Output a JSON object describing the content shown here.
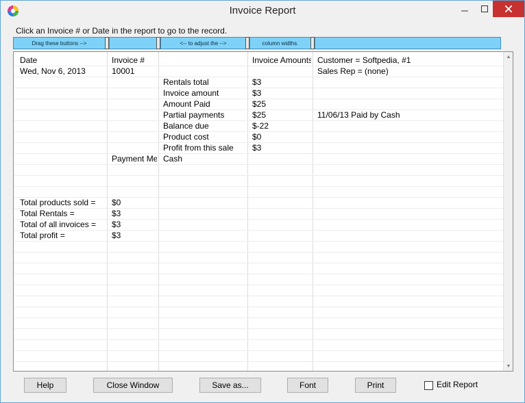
{
  "window": {
    "title": "Invoice Report",
    "icon": "app-color-wheel-icon"
  },
  "instruction": "Click an Invoice # or Date in the report to go to the record.",
  "column_handles": [
    "Drag these buttons -->",
    "<-- to adjust the -->",
    "column widths."
  ],
  "report": {
    "headers": [
      "Date",
      "Invoice #",
      "",
      "Invoice Amounts",
      "Customer = Softpedia, #1"
    ],
    "rows": [
      [
        "Wed, Nov 6, 2013",
        "10001",
        "",
        "",
        "Sales Rep = (none)"
      ],
      [
        "",
        "",
        "Rentals total",
        "$3",
        ""
      ],
      [
        "",
        "",
        "Invoice amount",
        "$3",
        ""
      ],
      [
        "",
        "",
        "Amount Paid",
        "$25",
        ""
      ],
      [
        "",
        "",
        "Partial payments",
        "$25",
        "11/06/13 Paid by Cash"
      ],
      [
        "",
        "",
        "Balance due",
        "$-22",
        ""
      ],
      [
        "",
        "",
        "Product cost",
        "$0",
        ""
      ],
      [
        "",
        "",
        "Profit from this sale",
        "$3",
        ""
      ],
      [
        "",
        "Payment Me",
        "Cash",
        "",
        ""
      ],
      [
        "",
        "",
        "",
        "",
        ""
      ],
      [
        "",
        "",
        "",
        "",
        ""
      ],
      [
        "",
        "",
        "",
        "",
        ""
      ],
      [
        "Total products sold =",
        "$0",
        "",
        "",
        ""
      ],
      [
        "Total Rentals =",
        "$3",
        "",
        "",
        ""
      ],
      [
        "Total of all invoices =",
        "$3",
        "",
        "",
        ""
      ],
      [
        "Total profit =",
        "$3",
        "",
        "",
        ""
      ]
    ]
  },
  "buttons": {
    "help": "Help",
    "close_window": "Close Window",
    "save_as": "Save as...",
    "font": "Font",
    "print": "Print"
  },
  "edit_report": {
    "label": "Edit Report",
    "checked": false
  },
  "colors": {
    "handle_fill": "#7fd2f7",
    "close_button": "#c7312f",
    "window_border": "#5ea5d6"
  }
}
